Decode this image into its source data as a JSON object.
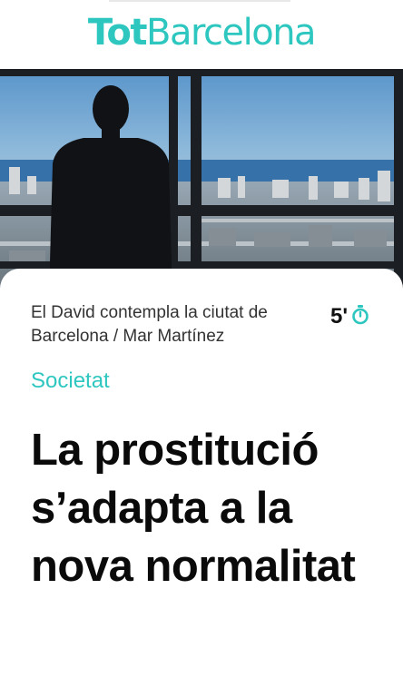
{
  "header": {
    "logo_part1": "Tot",
    "logo_part2": "Barcelona",
    "brand_color": "#2ec7c0"
  },
  "article": {
    "image_caption": "El David contempla la ciutat de Barcelona / Mar Martínez",
    "read_time": "5'",
    "read_time_icon": "stopwatch-icon",
    "section": "Societat",
    "headline": "La prostitució s’adapta a la nova normalitat"
  }
}
